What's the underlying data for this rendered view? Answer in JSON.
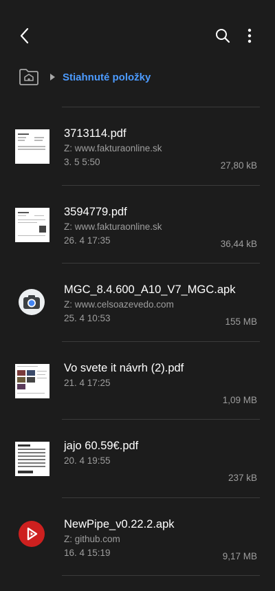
{
  "breadcrumb": {
    "label": "Stiahnuté položky"
  },
  "files": [
    {
      "name": "3713114.pdf",
      "source": "Z: www.fakturaonline.sk",
      "date": "3. 5 5:50",
      "size": "27,80 kB",
      "thumb": "pdf-invoice-thumbnail"
    },
    {
      "name": "3594779.pdf",
      "source": "Z: www.fakturaonline.sk",
      "date": "26. 4 17:35",
      "size": "36,44 kB",
      "thumb": "pdf-invoice-qr-thumbnail"
    },
    {
      "name": "MGC_8.4.600_A10_V7_MGC.apk",
      "source": "Z: www.celsoazevedo.com",
      "date": "25. 4 10:53",
      "size": "155 MB",
      "thumb": "camera-app-icon"
    },
    {
      "name": "Vo svete it návrh (2).pdf",
      "source": "",
      "date": "21. 4 17:25",
      "size": "1,09 MB",
      "thumb": "pdf-page-thumbnail"
    },
    {
      "name": "jajo 60.59€.pdf",
      "source": "",
      "date": "20. 4 19:55",
      "size": "237 kB",
      "thumb": "pdf-table-thumbnail"
    },
    {
      "name": "NewPipe_v0.22.2.apk",
      "source": "Z: github.com",
      "date": "16. 4 15:19",
      "size": "9,17 MB",
      "thumb": "newpipe-app-icon"
    }
  ],
  "colors": {
    "background": "#1c1c1c",
    "accent": "#4c9bff",
    "secondary_text": "#9e9e9e",
    "newpipe_red": "#cd201f"
  }
}
